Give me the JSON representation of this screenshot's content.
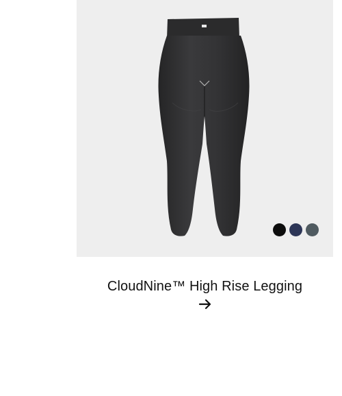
{
  "product": {
    "name": "CloudNine™ High Rise Legging",
    "image_icon": "leggings-product-image",
    "arrow_icon": "arrow-right-icon"
  },
  "swatches": [
    {
      "color": "#0d0d0d"
    },
    {
      "color": "#2c3556"
    },
    {
      "color": "#4f5a60"
    }
  ],
  "colors": {
    "image_bg": "#eeeeee",
    "text": "#111111",
    "legging": "#2f2f30"
  }
}
